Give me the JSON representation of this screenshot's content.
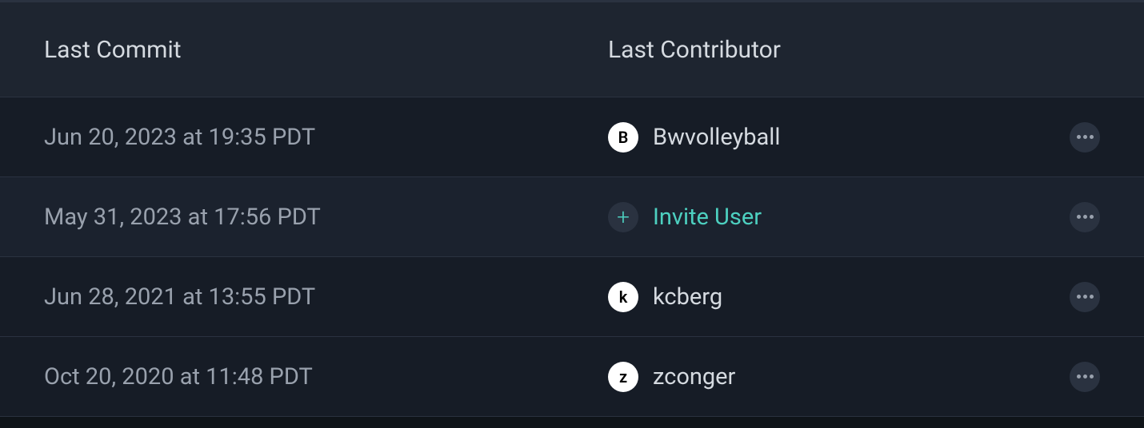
{
  "table": {
    "headers": {
      "commit": "Last Commit",
      "contributor": "Last Contributor"
    },
    "rows": [
      {
        "commit_time": "Jun 20, 2023 at 19:35 PDT",
        "contributor": {
          "type": "user",
          "avatar_letter": "B",
          "name": "Bwvolleyball"
        }
      },
      {
        "commit_time": "May 31, 2023 at 17:56 PDT",
        "contributor": {
          "type": "invite",
          "label": "Invite User"
        }
      },
      {
        "commit_time": "Jun 28, 2021 at 13:55 PDT",
        "contributor": {
          "type": "user",
          "avatar_letter": "k",
          "name": "kcberg"
        }
      },
      {
        "commit_time": "Oct 20, 2020 at 11:48 PDT",
        "contributor": {
          "type": "user",
          "avatar_letter": "z",
          "name": "zconger"
        }
      }
    ]
  }
}
